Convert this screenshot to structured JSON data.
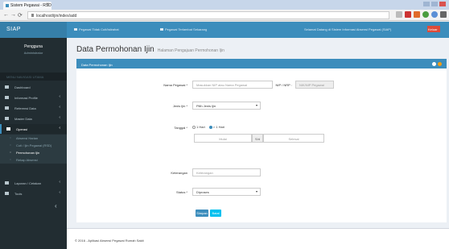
{
  "browser": {
    "tab_title": "Sistem Pegawai - RSD",
    "tab_close": "×",
    "url": "localhost/ijin/index/add",
    "nav": {
      "back": "←",
      "forward": "→",
      "reload": "⟳"
    }
  },
  "app": {
    "brand": "SIAP",
    "top_nav": [
      {
        "label": "Pegawai Tidak Cuti/Istirahat",
        "icon": "flag-icon"
      },
      {
        "label": "Pegawai Terlambat Sekarang",
        "icon": "flag-icon"
      }
    ],
    "user_label": "Selamat Datang di Sistem Informasi Absensi Pegawai (SIAP)",
    "badge": "Keluar"
  },
  "sidebar": {
    "profile_name": "Pengguna",
    "profile_sub": "Administrator",
    "header": "MENU NAVIGASI UTAMA",
    "items": [
      {
        "label": "Dashboard",
        "icon": "dashboard-icon",
        "chevron": ""
      },
      {
        "label": "Informasi Profile",
        "icon": "user-icon",
        "chevron": "‹"
      },
      {
        "label": "Referensi Data",
        "icon": "table-icon",
        "chevron": "‹"
      },
      {
        "label": "Master Data",
        "icon": "folder-icon",
        "chevron": "‹"
      },
      {
        "label": "Operasi",
        "icon": "edit-icon",
        "chevron": "‹"
      }
    ],
    "sub_items": [
      {
        "label": "Absensi Harian"
      },
      {
        "label": "Cuti / Ijin Pegawai (RSD)"
      },
      {
        "label": "Permohonan Ijin"
      },
      {
        "label": "Rekap Absensi"
      }
    ],
    "items_bottom": [
      {
        "label": "Laporan / Cetakan",
        "icon": "print-icon",
        "chevron": "‹"
      },
      {
        "label": "Tools",
        "icon": "wrench-icon",
        "chevron": "‹"
      }
    ],
    "collapse": "‹"
  },
  "page": {
    "title": "Data Permohonan Ijin",
    "subtitle": "Halaman Pengajuan Permohonan Ijin"
  },
  "form": {
    "box_title": "Data Permohonan Ijin",
    "fields": {
      "nama_label": "Nama Pegawai *",
      "nama_placeholder": "Masukkan NIP atau Nama Pegawai",
      "nip_label": "NIP / NRP :",
      "nip_value": "NIK/NIP Pegawai",
      "jenis_label": "Jenis Ijin *",
      "jenis_value": "Pilih Jenis Ijin",
      "tanggal_label": "Tanggal *",
      "radio_a": "1 Hari",
      "radio_b": "> 1 Hari",
      "from_value": "Mulai",
      "sd_label": "S/d",
      "to_value": "Selesai",
      "ket_label": "Keterangan",
      "ket_placeholder": "Keterangan",
      "status_label": "Status *",
      "status_value": "Diproses"
    },
    "buttons": {
      "save": "Simpan",
      "back": "Batal"
    }
  },
  "footer": {
    "text": "© 2016 - Aplikasi Absensi Pegawai Rumah Sakit"
  },
  "colors": {
    "primary": "#3c8dbc",
    "sidebar": "#222d32",
    "danger": "#dd4b39"
  }
}
